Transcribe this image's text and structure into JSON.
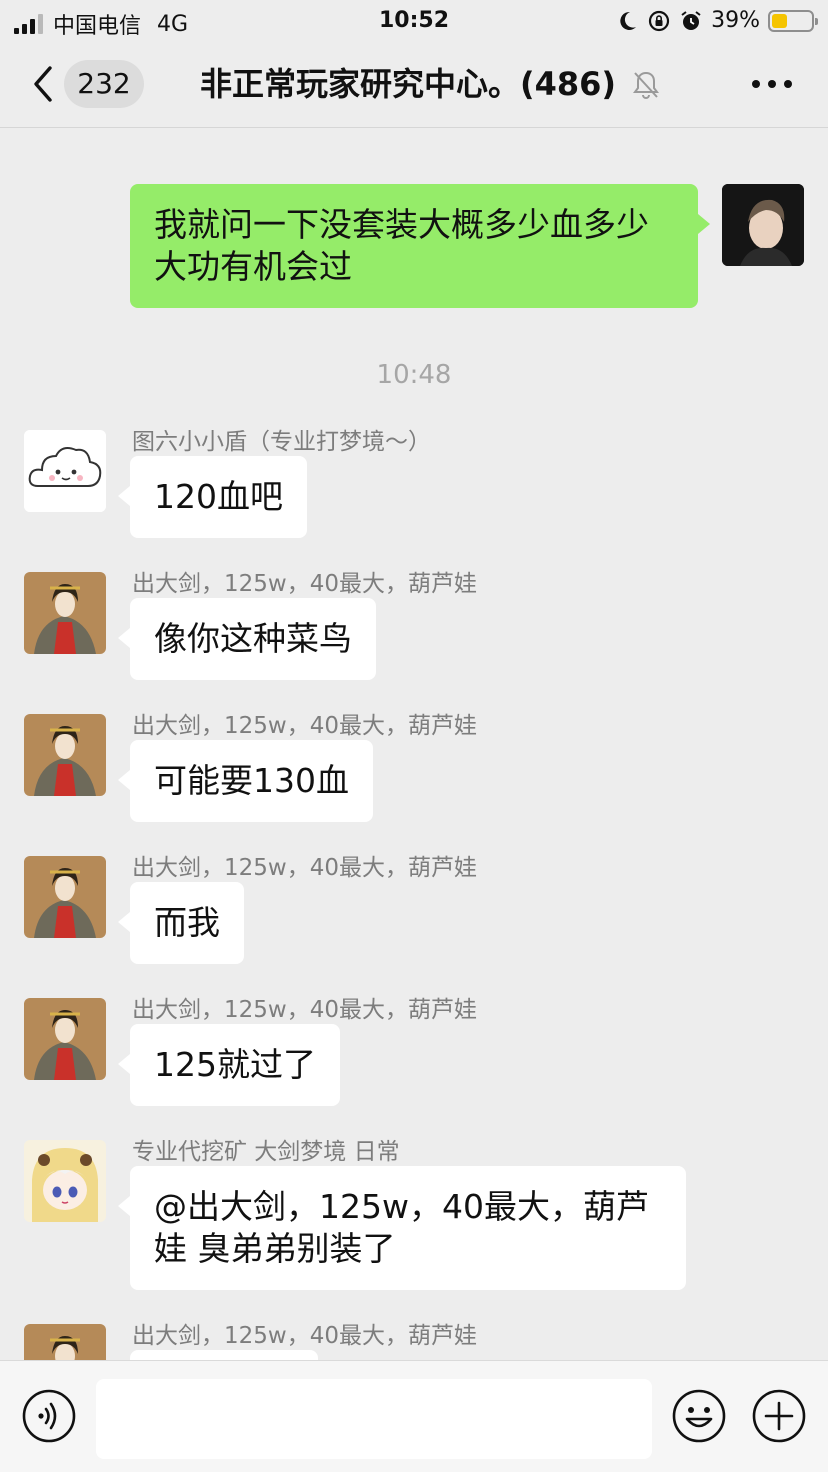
{
  "status_bar": {
    "carrier": "中国电信",
    "network": "4G",
    "time": "10:52",
    "battery_percent": "39%",
    "battery_level": 0.39
  },
  "nav": {
    "unread_count": "232",
    "title": "非正常玩家研究中心。(486)"
  },
  "messages": {
    "m0": {
      "text": "我就问一下没套装大概多少血多少大功有机会过"
    },
    "timestamp": "10:48",
    "m1": {
      "sender": "图六小小盾（专业打梦境～）",
      "text": "120血吧"
    },
    "m2": {
      "sender": "出大剑，125w，40最大，葫芦娃",
      "text": "像你这种菜鸟"
    },
    "m3": {
      "sender": "出大剑，125w，40最大，葫芦娃",
      "text": "可能要130血"
    },
    "m4": {
      "sender": "出大剑，125w，40最大，葫芦娃",
      "text": "而我"
    },
    "m5": {
      "sender": "出大剑，125w，40最大，葫芦娃",
      "text": "125就过了"
    },
    "m6": {
      "sender": "专业代挖矿 大剑梦境 日常",
      "text": "@出大剑，125w，40最大，葫芦娃 臭弟弟别装了"
    },
    "m7": {
      "sender": "出大剑，125w，40最大，葫芦娃"
    }
  },
  "input": {
    "value": ""
  },
  "colors": {
    "background": "#ededed",
    "bubble_self": "#95ec69",
    "bubble_other": "#ffffff",
    "battery_fill": "#f5c400"
  },
  "icons": [
    "signal-icon",
    "moon-icon",
    "rotation-lock-icon",
    "alarm-icon",
    "battery-icon",
    "back-chevron-icon",
    "mute-bell-icon",
    "more-dots-icon",
    "voice-icon",
    "emoji-icon",
    "plus-icon"
  ]
}
